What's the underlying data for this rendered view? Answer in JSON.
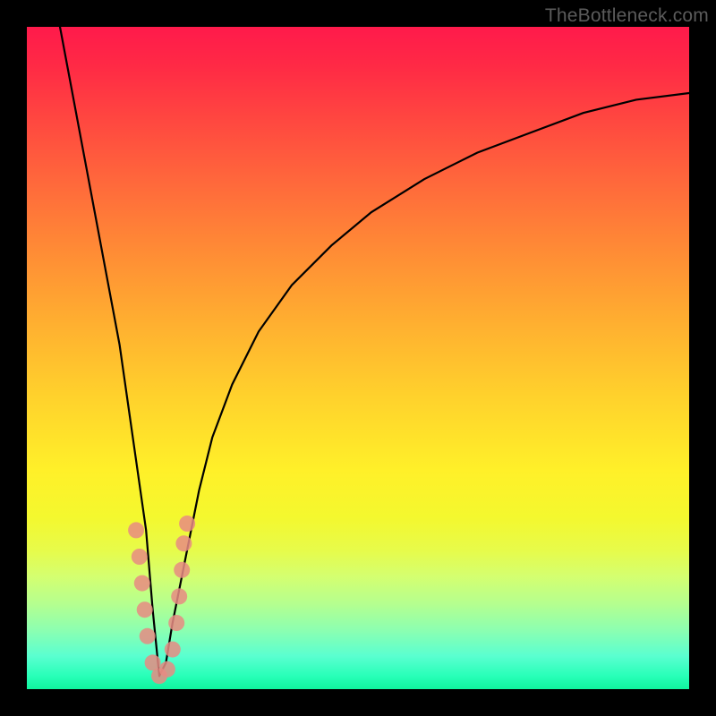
{
  "watermark": "TheBottleneck.com",
  "chart_data": {
    "type": "line",
    "title": "",
    "xlabel": "",
    "ylabel": "",
    "xlim": [
      0,
      100
    ],
    "ylim": [
      0,
      100
    ],
    "note": "Bottleneck-style V-curve. y≈0 at the optimal x; rises steeply away from optimum. Background gradient encodes badness (red high, green low).",
    "optimum_x": 20,
    "curve_points": {
      "x": [
        5,
        8,
        11,
        14,
        16,
        18,
        19,
        20,
        21,
        22,
        24,
        26,
        28,
        31,
        35,
        40,
        46,
        52,
        60,
        68,
        76,
        84,
        92,
        100
      ],
      "y": [
        100,
        84,
        68,
        52,
        38,
        24,
        12,
        2,
        4,
        10,
        20,
        30,
        38,
        46,
        54,
        61,
        67,
        72,
        77,
        81,
        84,
        87,
        89,
        90
      ]
    },
    "highlight_points": [
      {
        "x": 16.5,
        "y": 24
      },
      {
        "x": 17.0,
        "y": 20
      },
      {
        "x": 17.4,
        "y": 16
      },
      {
        "x": 17.8,
        "y": 12
      },
      {
        "x": 18.2,
        "y": 8
      },
      {
        "x": 19.0,
        "y": 4
      },
      {
        "x": 20.0,
        "y": 2
      },
      {
        "x": 21.2,
        "y": 3
      },
      {
        "x": 22.0,
        "y": 6
      },
      {
        "x": 22.6,
        "y": 10
      },
      {
        "x": 23.0,
        "y": 14
      },
      {
        "x": 23.4,
        "y": 18
      },
      {
        "x": 23.7,
        "y": 22
      },
      {
        "x": 24.2,
        "y": 25
      }
    ],
    "gradient_stops": [
      {
        "pos": 0,
        "color": "#ff1a4b"
      },
      {
        "pos": 50,
        "color": "#ffb030"
      },
      {
        "pos": 70,
        "color": "#fff029"
      },
      {
        "pos": 100,
        "color": "#10f59e"
      }
    ]
  }
}
